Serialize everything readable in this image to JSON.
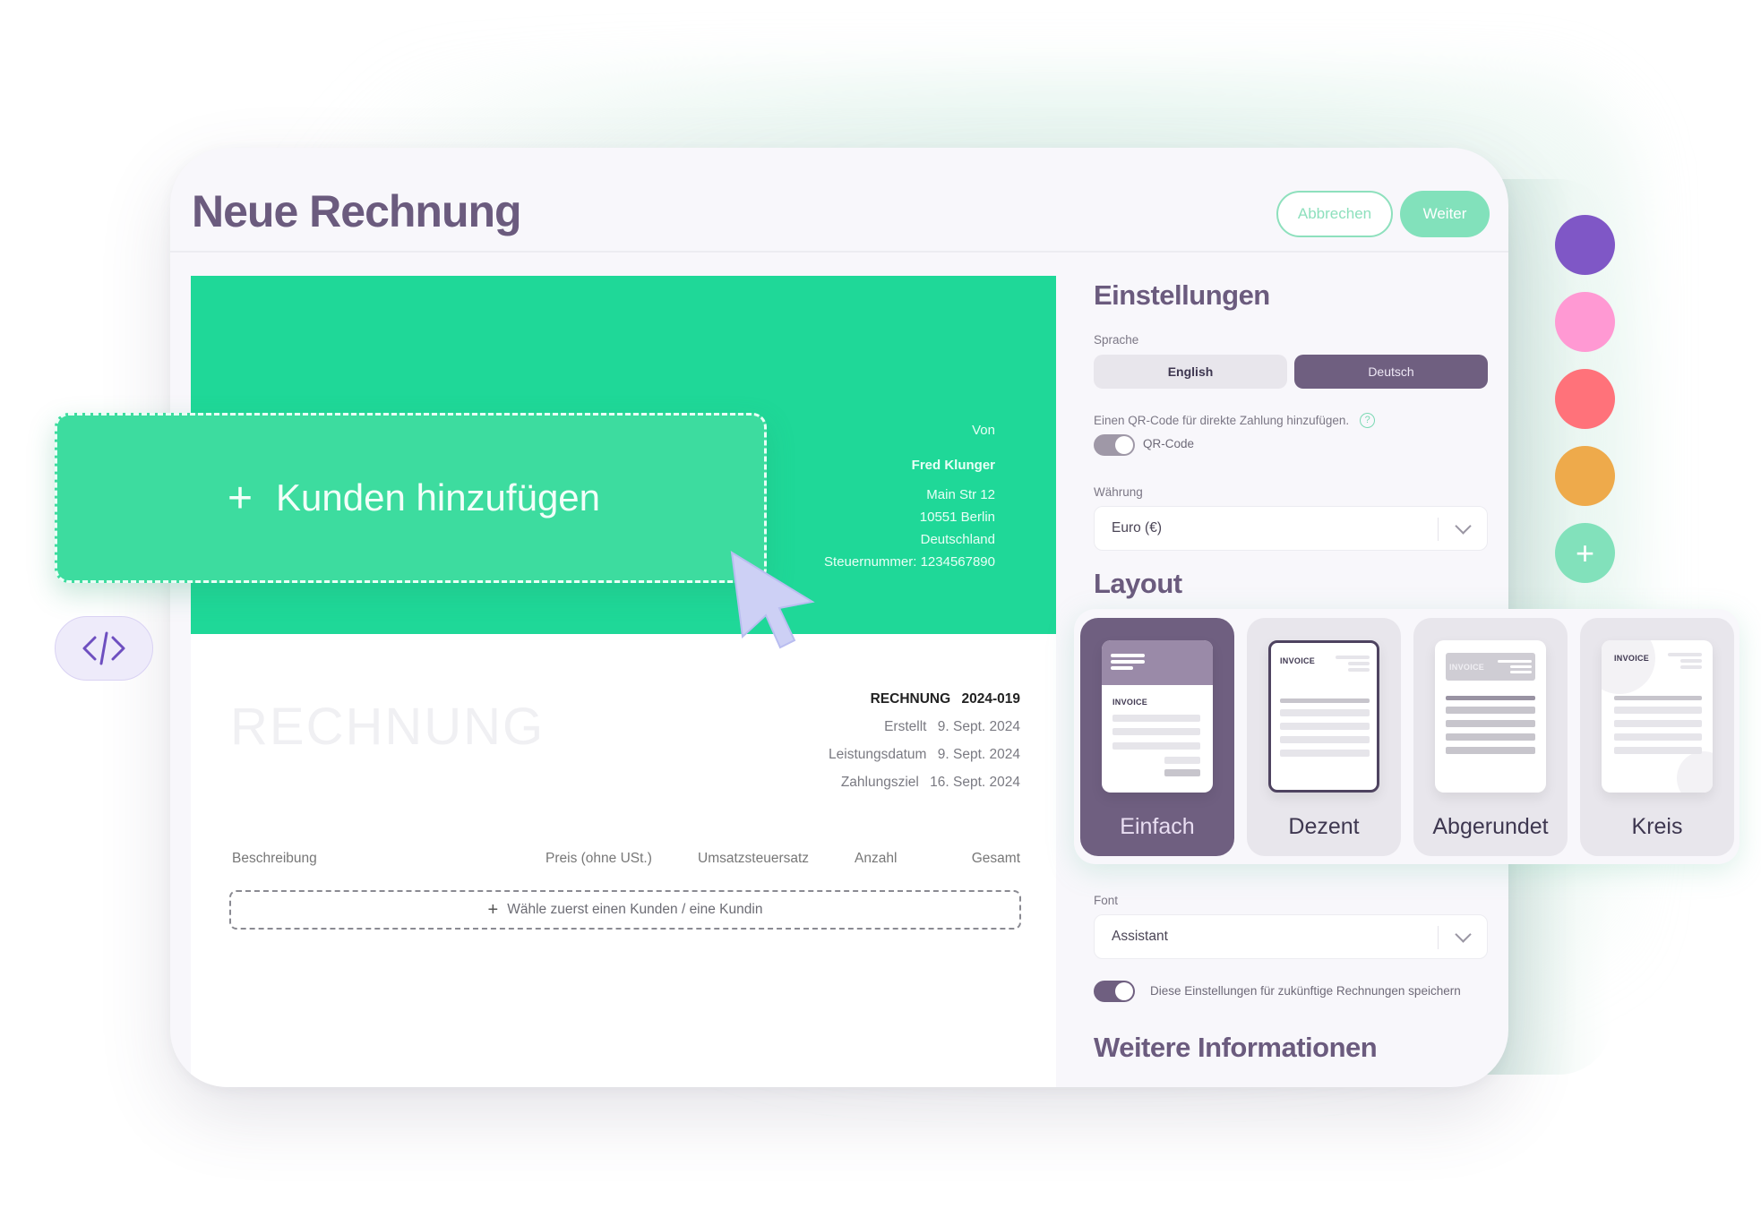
{
  "header": {
    "title": "Neue Rechnung",
    "cancel_label": "Abbrechen",
    "next_label": "Weiter"
  },
  "invoice": {
    "sender": {
      "label": "Von",
      "name": "Fred Klunger",
      "street": "Main Str 12",
      "city": "10551 Berlin",
      "country": "Deutschland",
      "tax_id": "Steuernummer: 1234567890"
    },
    "watermark": "RECHNUNG",
    "number_label": "RECHNUNG",
    "number": "2024-019",
    "dates": [
      {
        "label": "Erstellt",
        "value": "9. Sept. 2024"
      },
      {
        "label": "Leistungsdatum",
        "value": "9. Sept. 2024"
      },
      {
        "label": "Zahlungsziel",
        "value": "16. Sept. 2024"
      }
    ],
    "columns": [
      "Beschreibung",
      "Preis (ohne USt.)",
      "Umsatzsteuersatz",
      "Anzahl",
      "Gesamt"
    ],
    "add_line_label": "Wähle zuerst einen Kunden / eine Kundin",
    "add_client_label": "Kunden hinzufügen"
  },
  "settings": {
    "title": "Einstellungen",
    "language_label": "Sprache",
    "languages": [
      "English",
      "Deutsch"
    ],
    "language_selected": "Deutsch",
    "qr_description": "Einen QR-Code für direkte Zahlung hinzufügen.",
    "qr_toggle_label": "QR-Code",
    "qr_enabled": true,
    "currency_label": "Währung",
    "currency_value": "Euro (€)",
    "layout_title": "Layout",
    "layouts": [
      {
        "name": "Einfach",
        "preview_text": "INVOICE",
        "selected": true
      },
      {
        "name": "Dezent",
        "preview_text": "INVOICE",
        "selected": false
      },
      {
        "name": "Abgerundet",
        "preview_text": "INVOICE",
        "selected": false
      },
      {
        "name": "Kreis",
        "preview_text": "INVOICE",
        "selected": false
      }
    ],
    "font_label": "Font",
    "font_value": "Assistant",
    "save_toggle_label": "Diese Einstellungen für zukünftige Rechnungen speichern",
    "save_enabled": true,
    "more_info_title": "Weitere Informationen"
  },
  "colors": {
    "accent": "#1fd898",
    "primary": "#6f5f80",
    "swatches": [
      "#7f57c6",
      "#ff99d3",
      "#ff727a",
      "#eeaa4b"
    ],
    "add_swatch": "#82e1bb"
  },
  "icons": {
    "code": "code-icon",
    "plus": "+"
  }
}
